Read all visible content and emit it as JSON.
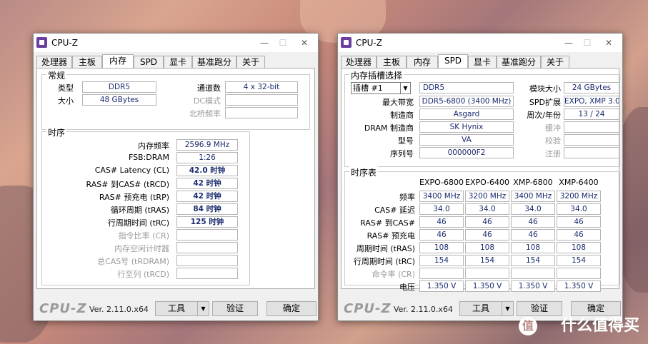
{
  "left": {
    "title": "CPU-Z",
    "tabs": [
      "处理器",
      "主板",
      "内存",
      "SPD",
      "显卡",
      "基准跑分",
      "关于"
    ],
    "general": {
      "legend": "常规",
      "type_label": "类型",
      "type_value": "DDR5",
      "size_label": "大小",
      "size_value": "48 GBytes",
      "channels_label": "通道数",
      "channels_value": "4 x 32-bit",
      "dc_label": "DC模式",
      "dc_value": "",
      "nb_label": "北桥频率",
      "nb_value": ""
    },
    "timings": {
      "legend": "时序",
      "rows": [
        {
          "label": "内存频率",
          "value": "2596.9 MHz",
          "dim": false
        },
        {
          "label": "FSB:DRAM",
          "value": "1:26",
          "dim": false
        },
        {
          "label": "CAS# Latency (CL)",
          "value": "42.0 时钟",
          "dim": false
        },
        {
          "label": "RAS# 到CAS# (tRCD)",
          "value": "42 时钟",
          "dim": false
        },
        {
          "label": "RAS# 预充电 (tRP)",
          "value": "42 时钟",
          "dim": false
        },
        {
          "label": "循环周期 (tRAS)",
          "value": "84 时钟",
          "dim": false
        },
        {
          "label": "行周期时间 (tRC)",
          "value": "125 时钟",
          "dim": false
        },
        {
          "label": "指令比率 (CR)",
          "value": "",
          "dim": true
        },
        {
          "label": "内存空闲计时器",
          "value": "",
          "dim": true
        },
        {
          "label": "总CAS号 (tRDRAM)",
          "value": "",
          "dim": true
        },
        {
          "label": "行至列 (tRCD)",
          "value": "",
          "dim": true
        }
      ]
    },
    "footer": {
      "logo": "CPU-Z",
      "version": "Ver. 2.11.0.x64",
      "tools": "工具",
      "validate": "验证",
      "ok": "确定"
    }
  },
  "right": {
    "title": "CPU-Z",
    "tabs": [
      "处理器",
      "主板",
      "内存",
      "SPD",
      "显卡",
      "基准跑分",
      "关于"
    ],
    "slot": {
      "legend": "内存插槽选择",
      "slot_value": "插槽 #1",
      "type_value": "DDR5",
      "bw_label": "最大带宽",
      "bw_value": "DDR5-6800 (3400 MHz)",
      "mfr_label": "制造商",
      "mfr_value": "Asgard",
      "dram_label": "DRAM 制造商",
      "dram_value": "SK Hynix",
      "pn_label": "型号",
      "pn_value": "VA",
      "sn_label": "序列号",
      "sn_value": "000000F2",
      "modsize_label": "模块大小",
      "modsize_value": "24 GBytes",
      "spdext_label": "SPD扩展",
      "spdext_value": "EXPO, XMP 3.0",
      "week_label": "周次/年份",
      "week_value": "13 / 24",
      "buffer_label": "缓冲",
      "buffer_value": "",
      "check_label": "校验",
      "check_value": "",
      "reg_label": "注册",
      "reg_value": ""
    },
    "timing_table": {
      "legend": "时序表",
      "columns": [
        "EXPO-6800",
        "EXPO-6400",
        "XMP-6800",
        "XMP-6400"
      ],
      "rows": [
        {
          "label": "频率",
          "values": [
            "3400 MHz",
            "3200 MHz",
            "3400 MHz",
            "3200 MHz"
          ],
          "dim": false
        },
        {
          "label": "CAS# 延迟",
          "values": [
            "34.0",
            "34.0",
            "34.0",
            "34.0"
          ],
          "dim": false
        },
        {
          "label": "RAS# 到CAS#",
          "values": [
            "46",
            "46",
            "46",
            "46"
          ],
          "dim": false
        },
        {
          "label": "RAS# 预充电",
          "values": [
            "46",
            "46",
            "46",
            "46"
          ],
          "dim": false
        },
        {
          "label": "周期时间 (tRAS)",
          "values": [
            "108",
            "108",
            "108",
            "108"
          ],
          "dim": false
        },
        {
          "label": "行周期时间 (tRC)",
          "values": [
            "154",
            "154",
            "154",
            "154"
          ],
          "dim": false
        },
        {
          "label": "命令率 (CR)",
          "values": [
            "",
            "",
            "",
            ""
          ],
          "dim": true
        },
        {
          "label": "电压",
          "values": [
            "1.350 V",
            "1.350 V",
            "1.350 V",
            "1.350 V"
          ],
          "dim": false
        }
      ]
    },
    "footer": {
      "logo": "CPU-Z",
      "version": "Ver. 2.11.0.x64",
      "tools": "工具",
      "validate": "验证",
      "ok": "确定"
    }
  },
  "watermark": {
    "circle": "值",
    "text": "什么值得买"
  }
}
